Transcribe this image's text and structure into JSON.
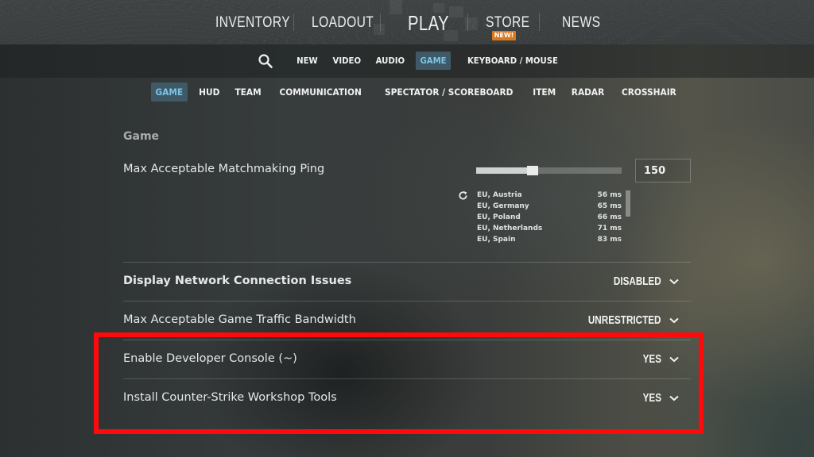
{
  "top_nav": {
    "items": [
      {
        "label": "INVENTORY"
      },
      {
        "label": "LOADOUT"
      },
      {
        "label": "PLAY"
      },
      {
        "label": "STORE",
        "badge": "NEW!"
      },
      {
        "label": "NEWS"
      }
    ],
    "badge_color": "#d9781f"
  },
  "settings_tabs": {
    "search_icon": "search-icon",
    "items": [
      {
        "label": "NEW"
      },
      {
        "label": "VIDEO"
      },
      {
        "label": "AUDIO"
      },
      {
        "label": "GAME",
        "active": true
      },
      {
        "label": "KEYBOARD / MOUSE"
      }
    ],
    "active_color": "#7cc4e8"
  },
  "game_subtabs": {
    "items": [
      {
        "label": "GAME",
        "active": true
      },
      {
        "label": "HUD"
      },
      {
        "label": "TEAM"
      },
      {
        "label": "COMMUNICATION"
      },
      {
        "label": "SPECTATOR / SCOREBOARD"
      },
      {
        "label": "ITEM"
      },
      {
        "label": "RADAR"
      },
      {
        "label": "CROSSHAIR"
      }
    ]
  },
  "section": {
    "title": "Game",
    "settings": {
      "matchmaking_ping": {
        "label": "Max Acceptable Matchmaking Ping",
        "value": "150",
        "slider_fraction": 0.39,
        "servers": [
          {
            "name": "EU, Austria",
            "ping": "56 ms"
          },
          {
            "name": "EU, Germany",
            "ping": "65 ms"
          },
          {
            "name": "EU, Poland",
            "ping": "66 ms"
          },
          {
            "name": "EU, Netherlands",
            "ping": "71 ms"
          },
          {
            "name": "EU, Spain",
            "ping": "83 ms"
          }
        ]
      },
      "network_issues": {
        "label": "Display Network Connection Issues",
        "value": "DISABLED"
      },
      "traffic_bandwidth": {
        "label": "Max Acceptable Game Traffic Bandwidth",
        "value": "UNRESTRICTED"
      },
      "developer_console": {
        "label": "Enable Developer Console (~)",
        "value": "YES"
      },
      "workshop_tools": {
        "label": "Install Counter-Strike Workshop Tools",
        "value": "YES"
      }
    }
  },
  "annotation": {
    "highlight_color": "#ff0a0a"
  }
}
